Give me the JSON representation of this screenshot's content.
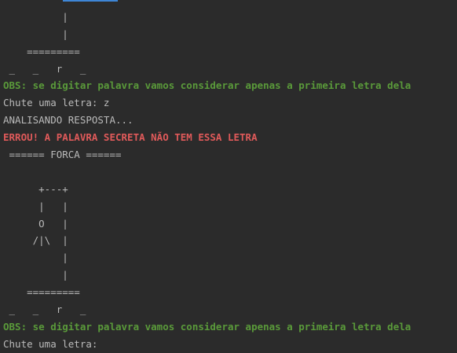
{
  "console": {
    "colors": {
      "background": "#2b2b2b",
      "text": "#bbbbbb",
      "obs": "#5a9a3a",
      "error": "#e05a5a"
    },
    "lines": [
      {
        "text": "",
        "style": "normal"
      },
      {
        "text": "          |",
        "style": "normal"
      },
      {
        "text": "          |",
        "style": "normal"
      },
      {
        "text": "    =========",
        "style": "normal"
      },
      {
        "text": " _   _   r   _",
        "style": "normal"
      },
      {
        "text": "OBS: se digitar palavra vamos considerar apenas a primeira letra dela",
        "style": "green"
      },
      {
        "text": "Chute uma letra: z",
        "style": "normal"
      },
      {
        "text": "ANALISANDO RESPOSTA...",
        "style": "normal"
      },
      {
        "text": "ERROU! A PALAVRA SECRETA NÃO TEM ESSA LETRA",
        "style": "red"
      },
      {
        "text": " ====== FORCA ======",
        "style": "normal"
      },
      {
        "text": "",
        "style": "normal"
      },
      {
        "text": "      +---+",
        "style": "normal"
      },
      {
        "text": "      |   |",
        "style": "normal"
      },
      {
        "text": "      O   |",
        "style": "normal"
      },
      {
        "text": "     /|\\  |",
        "style": "normal"
      },
      {
        "text": "          |",
        "style": "normal"
      },
      {
        "text": "          |",
        "style": "normal"
      },
      {
        "text": "    =========",
        "style": "normal"
      },
      {
        "text": " _   _   r   _",
        "style": "normal"
      },
      {
        "text": "OBS: se digitar palavra vamos considerar apenas a primeira letra dela",
        "style": "green"
      },
      {
        "text": "Chute uma letra: ",
        "style": "normal"
      }
    ]
  }
}
